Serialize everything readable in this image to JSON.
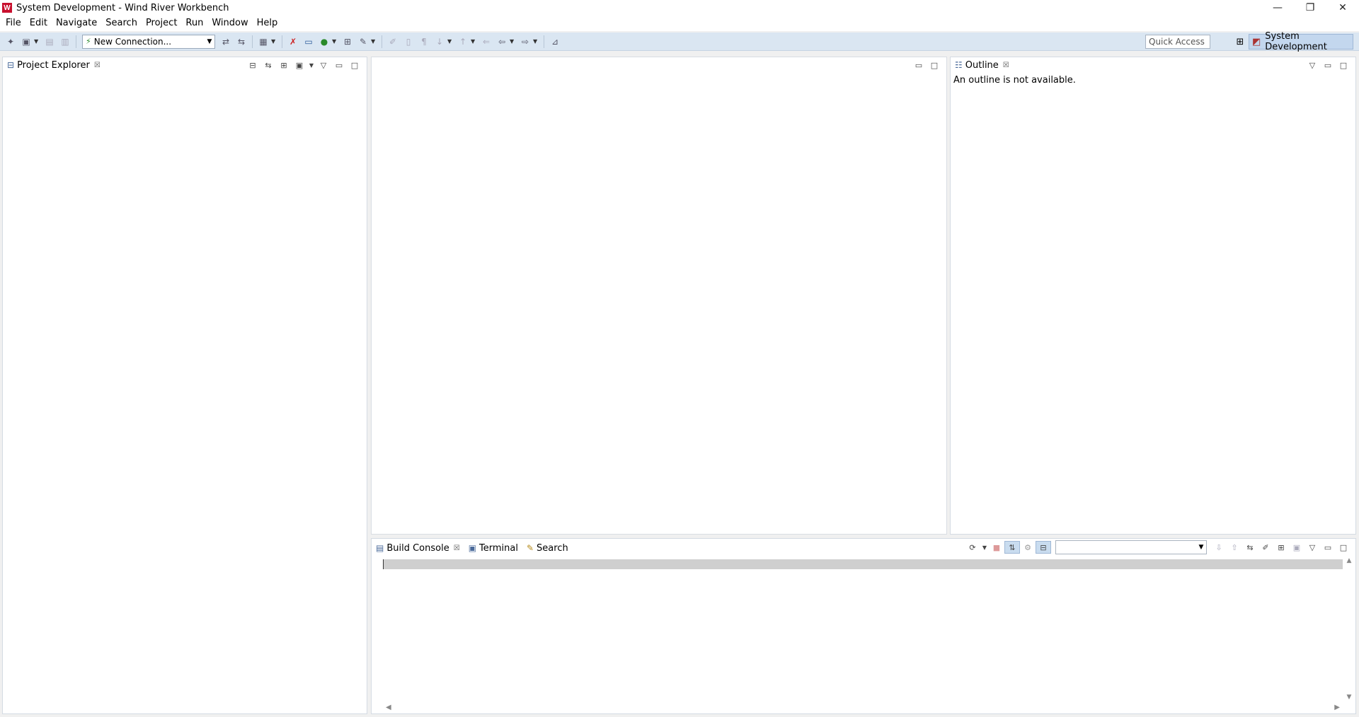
{
  "window": {
    "title": "System Development - Wind River Workbench",
    "logo_letter": "W",
    "controls": [
      "—",
      "❐",
      "✕"
    ]
  },
  "menu": [
    "File",
    "Edit",
    "Navigate",
    "Search",
    "Project",
    "Run",
    "Window",
    "Help"
  ],
  "toolbar": {
    "connection_combo": "New Connection...",
    "quick_access": "Quick Access",
    "perspective": "System Development"
  },
  "project_explorer": {
    "tab_label": "Project Explorer"
  },
  "outline": {
    "tab_label": "Outline",
    "message": "An outline is not available."
  },
  "bottom": {
    "tabs": [
      "Build Console",
      "Terminal",
      "Search"
    ]
  },
  "colors": {
    "toolbar_bg": "#dae6f2",
    "accent": "#c3d7ee",
    "logo": "#c8102e"
  }
}
